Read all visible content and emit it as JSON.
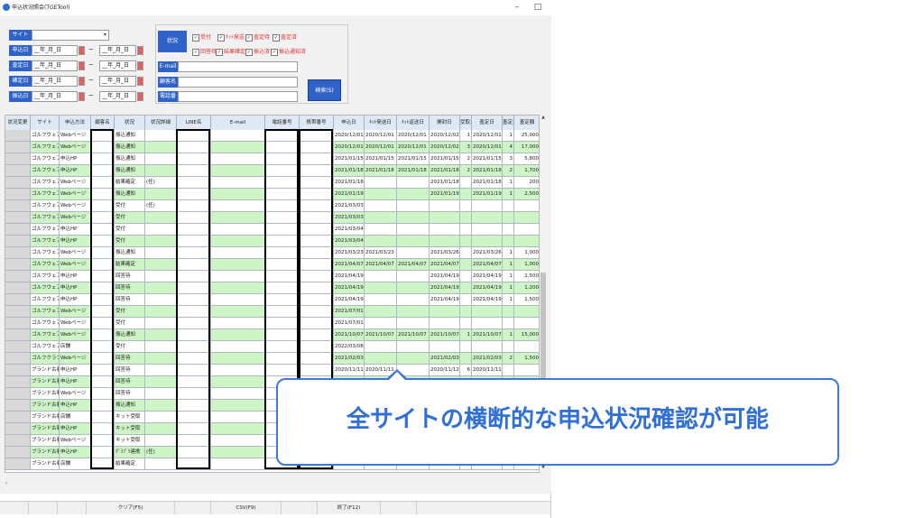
{
  "window": {
    "title": "申込状況照会(TGETool)",
    "min": "–",
    "max": "□"
  },
  "filters": {
    "site_label": "サイト",
    "dates": [
      {
        "label": "申込日",
        "from": "__年_月_日",
        "to": "__年_月_日"
      },
      {
        "label": "査定日",
        "from": "__年_月_日",
        "to": "__年_月_日"
      },
      {
        "label": "確定日",
        "from": "__年_月_日",
        "to": "__年_月_日"
      },
      {
        "label": "振込日",
        "from": "__年_月_日",
        "to": "__年_月_日"
      }
    ],
    "tilde": "~",
    "status_label": "状況",
    "checks": [
      {
        "label": "受付",
        "checked": true
      },
      {
        "label": "ｷｯﾄ発送",
        "checked": true
      },
      {
        "label": "査定待",
        "checked": true
      },
      {
        "label": "査定済",
        "checked": true
      },
      {
        "label": "回答待",
        "checked": true
      },
      {
        "label": "結果確定",
        "checked": true
      },
      {
        "label": "振込済",
        "checked": true
      },
      {
        "label": "振込通知済",
        "checked": true
      }
    ],
    "email_label": "E-mail",
    "customer_label": "顧客名",
    "phone_label": "電話番号",
    "search_button": "検索(S)"
  },
  "grid": {
    "columns": [
      "状況変更",
      "サイト",
      "申込方法",
      "顧客名",
      "状況",
      "状況詳細",
      "LINE名",
      "E-mail",
      "電話番号",
      "携帯番号",
      "申込日",
      "ｷｯﾄ発送日",
      "ｷｯﾄ返送日",
      "開封日",
      "受取点数",
      "査定日",
      "査定点数",
      "査定額"
    ],
    "rows": [
      [
        "",
        "ゴルフウェア",
        "Webページ",
        "",
        "振込通知",
        "",
        "",
        "",
        "",
        "",
        "2020/12/01",
        "2020/12/01",
        "2020/12/01",
        "2020/12/02",
        "1",
        "2020/12/01",
        "1",
        "25,000"
      ],
      [
        "",
        "ゴルフウェア",
        "Webページ",
        "",
        "振込通知",
        "",
        "",
        "",
        "",
        "",
        "2020/12/01",
        "2020/12/01",
        "2020/12/01",
        "2020/12/02",
        "3",
        "2020/12/01",
        "4",
        "17,000"
      ],
      [
        "",
        "ゴルフウェア",
        "申込HP",
        "",
        "振込通知",
        "",
        "",
        "",
        "",
        "",
        "2021/01/15",
        "2021/01/15",
        "2021/01/15",
        "2021/01/15",
        "2",
        "2021/01/15",
        "3",
        "5,800"
      ],
      [
        "",
        "ゴルフウェア",
        "申込HP",
        "",
        "振込通知",
        "",
        "",
        "",
        "",
        "",
        "2021/01/18",
        "2021/01/18",
        "2021/01/18",
        "2021/01/18",
        "2",
        "2021/01/18",
        "2",
        "1,700"
      ],
      [
        "",
        "ゴルフウェア",
        "Webページ",
        "",
        "結果確定",
        "(任)",
        "",
        "",
        "",
        "",
        "2021/01/18",
        "",
        "",
        "2021/01/18",
        "",
        "2021/01/18",
        "1",
        "200"
      ],
      [
        "",
        "ゴルフウェア",
        "Webページ",
        "",
        "振込通知",
        "",
        "",
        "",
        "",
        "",
        "2021/01/19",
        "",
        "",
        "2021/01/19",
        "",
        "2021/01/19",
        "1",
        "2,500"
      ],
      [
        "",
        "ゴルフウェア",
        "Webページ",
        "",
        "受付",
        "(任)",
        "",
        "",
        "",
        "",
        "2021/03/03",
        "",
        "",
        "",
        "",
        "",
        "",
        ""
      ],
      [
        "",
        "ゴルフウェア",
        "Webページ",
        "",
        "受付",
        "",
        "",
        "",
        "",
        "",
        "2021/03/03",
        "",
        "",
        "",
        "",
        "",
        "",
        ""
      ],
      [
        "",
        "ゴルフウェア",
        "申込HP",
        "",
        "受付",
        "",
        "",
        "",
        "",
        "",
        "2021/03/04",
        "",
        "",
        "",
        "",
        "",
        "",
        ""
      ],
      [
        "",
        "ゴルフウェア",
        "申込HP",
        "",
        "受付",
        "",
        "",
        "",
        "",
        "",
        "2021/03/04",
        "",
        "",
        "",
        "",
        "",
        "",
        ""
      ],
      [
        "",
        "ゴルフウェア",
        "Webページ",
        "",
        "振込通知",
        "",
        "",
        "",
        "",
        "",
        "2021/03/23",
        "2021/03/23",
        "",
        "2021/03/26",
        "",
        "2021/03/26",
        "1",
        "1,000"
      ],
      [
        "",
        "ゴルフウェア",
        "Webページ",
        "",
        "結果確定",
        "",
        "",
        "",
        "",
        "",
        "2021/04/07",
        "2021/04/07",
        "2021/04/07",
        "2021/04/07",
        "",
        "2021/04/07",
        "1",
        "1,000"
      ],
      [
        "",
        "ゴルフウェア",
        "申込HP",
        "",
        "回答待",
        "",
        "",
        "",
        "",
        "",
        "2021/04/19",
        "",
        "",
        "2021/04/19",
        "",
        "2021/04/19",
        "1",
        "1,500"
      ],
      [
        "",
        "ゴルフウェア",
        "申込HP",
        "",
        "回答待",
        "",
        "",
        "",
        "",
        "",
        "2021/04/19",
        "",
        "",
        "2021/04/19",
        "",
        "2021/04/19",
        "1",
        "1,200"
      ],
      [
        "",
        "ゴルフウェア",
        "申込HP",
        "",
        "回答待",
        "",
        "",
        "",
        "",
        "",
        "2021/04/19",
        "",
        "",
        "2021/04/19",
        "",
        "2021/04/19",
        "1",
        "1,500"
      ],
      [
        "",
        "ゴルフウェア",
        "Webページ",
        "",
        "受付",
        "",
        "",
        "",
        "",
        "",
        "2021/07/01",
        "",
        "",
        "",
        "",
        "",
        "",
        ""
      ],
      [
        "",
        "ゴルフウェア",
        "Webページ",
        "",
        "受付",
        "",
        "",
        "",
        "",
        "",
        "2021/07/01",
        "",
        "",
        "",
        "",
        "",
        "",
        ""
      ],
      [
        "",
        "ゴルフウェア",
        "Webページ",
        "",
        "振込通知",
        "",
        "",
        "",
        "",
        "",
        "2021/10/07",
        "2021/10/07",
        "2021/10/07",
        "2021/10/07",
        "1",
        "2021/10/07",
        "1",
        "15,000"
      ],
      [
        "",
        "ゴルフウェア",
        "店舗",
        "",
        "受付",
        "",
        "",
        "",
        "",
        "",
        "2022/03/08",
        "",
        "",
        "",
        "",
        "",
        "",
        ""
      ],
      [
        "",
        "ゴルフクラブ",
        "Webページ",
        "",
        "回答待",
        "",
        "",
        "",
        "",
        "",
        "2021/02/03",
        "",
        "",
        "2021/02/03",
        "",
        "2021/02/03",
        "2",
        "1,500"
      ],
      [
        "",
        "ブランド古着",
        "申込HP",
        "",
        "回答待",
        "",
        "",
        "",
        "",
        "",
        "2020/11/11",
        "2020/11/11",
        "",
        "2020/11/12",
        "6",
        "2020/11/11",
        "",
        ""
      ],
      [
        "",
        "ブランド古着",
        "申込HP",
        "",
        "回答待",
        "",
        "",
        "",
        "",
        "",
        "",
        "",
        "",
        "",
        "",
        "",
        "",
        ""
      ],
      [
        "",
        "ブランド古着",
        "Webページ",
        "",
        "回答待",
        "",
        "",
        "",
        "",
        "",
        "",
        "",
        "",
        "",
        "",
        "",
        "",
        ""
      ],
      [
        "",
        "ブランド古着",
        "申込HP",
        "",
        "振込通知",
        "",
        "",
        "",
        "",
        "",
        "",
        "",
        "",
        "",
        "",
        "",
        "",
        ""
      ],
      [
        "",
        "ブランド古着",
        "店舗",
        "",
        "キット受取",
        "",
        "",
        "",
        "",
        "",
        "",
        "",
        "",
        "",
        "",
        "",
        "",
        ""
      ],
      [
        "",
        "ブランド古着",
        "申込HP",
        "",
        "キット受取",
        "",
        "",
        "",
        "",
        "",
        "",
        "",
        "",
        "",
        "",
        "",
        "",
        ""
      ],
      [
        "",
        "ブランド古着",
        "Webページ",
        "",
        "キット受取",
        "",
        "",
        "",
        "",
        "",
        "",
        "",
        "",
        "",
        "",
        "",
        "",
        ""
      ],
      [
        "",
        "ブランド古着",
        "申込HP",
        "",
        "ｸﾞﾗﾌﾞﾘ連携",
        "(任)",
        "",
        "",
        "",
        "",
        "",
        "",
        "",
        "",
        "",
        "",
        "",
        ""
      ],
      [
        "",
        "ブランド古着",
        "店舗",
        "",
        "結果確定",
        "",
        "",
        "",
        "",
        "",
        "",
        "",
        "",
        "",
        "",
        "",
        "",
        ""
      ]
    ]
  },
  "footer": {
    "clear": "クリア(F5)",
    "csv": "CSV(F9)",
    "exit": "終了(F12)"
  },
  "callout": {
    "text": "全サイトの横断的な申込状況確認が可能"
  },
  "colors": {
    "accent": "#2f63c9",
    "row_green": "#cdf5c6",
    "callout": "#2f6fd6"
  }
}
